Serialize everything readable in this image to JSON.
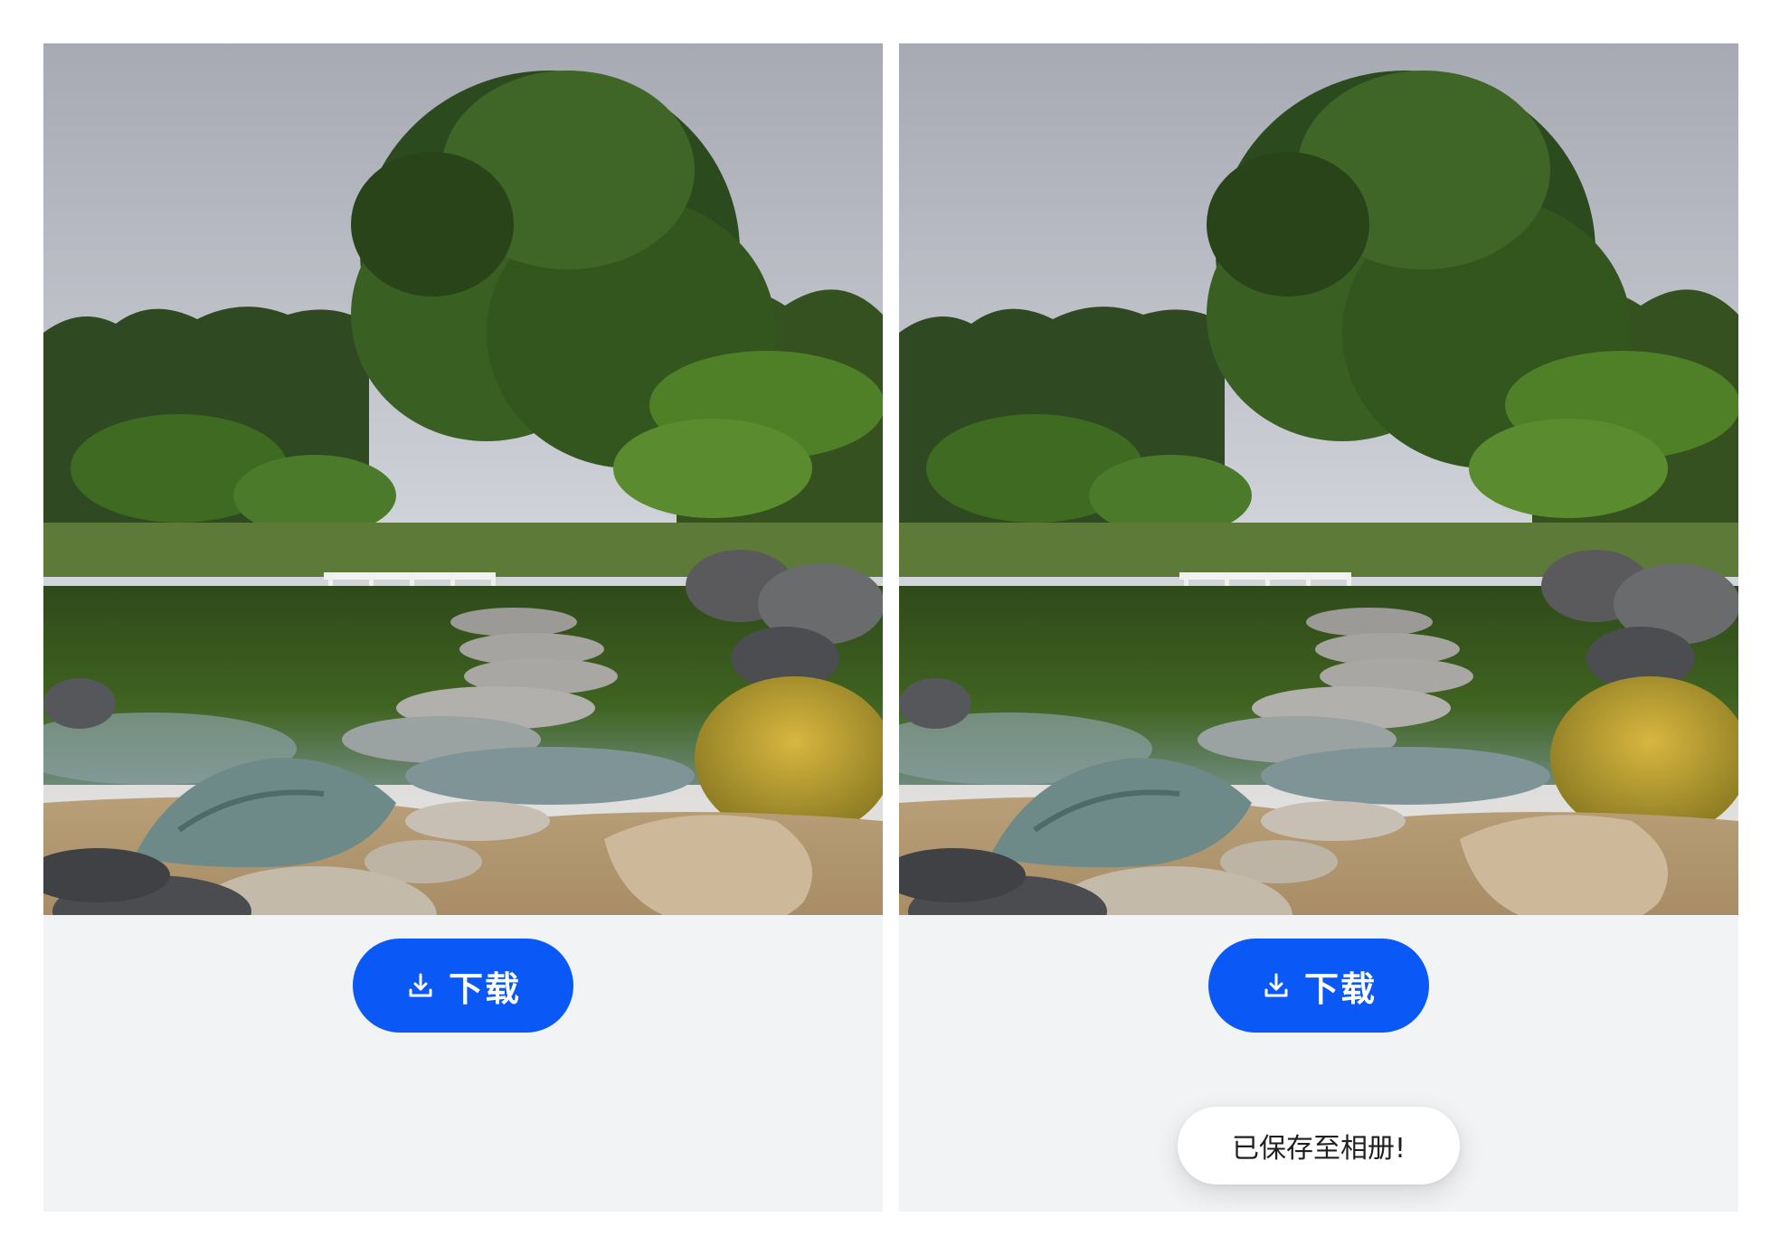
{
  "accent_color": "#0a59f7",
  "before_screen": {
    "photo_alt": "",
    "download_button": {
      "icon": "download-icon",
      "label": "下载"
    }
  },
  "after_screen": {
    "photo_alt": "",
    "download_button": {
      "icon": "download-icon",
      "label": "下载"
    },
    "toast": {
      "text": "已保存至相册!"
    }
  }
}
